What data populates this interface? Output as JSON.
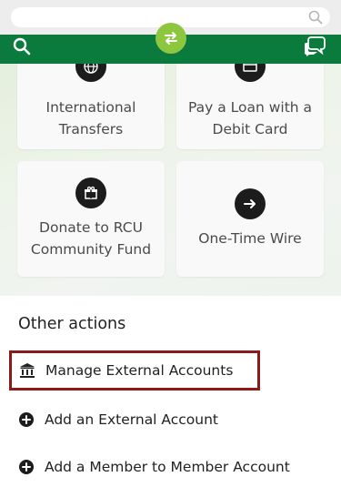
{
  "colors": {
    "brand_green": "#0a7a3d",
    "accent_lime": "#8dc63f",
    "highlight_red": "#8b1a1a"
  },
  "header": {
    "icons": [
      "search-icon",
      "transfer-icon",
      "chat-icon"
    ]
  },
  "tiles": [
    {
      "line1": "International",
      "line2": "Transfers",
      "icon": "globe-icon"
    },
    {
      "line1": "Pay a Loan with a",
      "line2": "Debit Card",
      "icon": "card-icon"
    },
    {
      "line1": "Donate to RCU",
      "line2": "Community Fund",
      "icon": "gift-icon"
    },
    {
      "line1": "One-Time Wire",
      "line2": "",
      "icon": "arrow-right-icon"
    }
  ],
  "other_actions": {
    "title": "Other actions",
    "items": [
      {
        "label": "Manage External Accounts",
        "icon": "bank-icon"
      },
      {
        "label": "Add an External Account",
        "icon": "plus-circle-icon"
      },
      {
        "label": "Add a Member to Member Account",
        "icon": "plus-circle-icon"
      }
    ]
  }
}
